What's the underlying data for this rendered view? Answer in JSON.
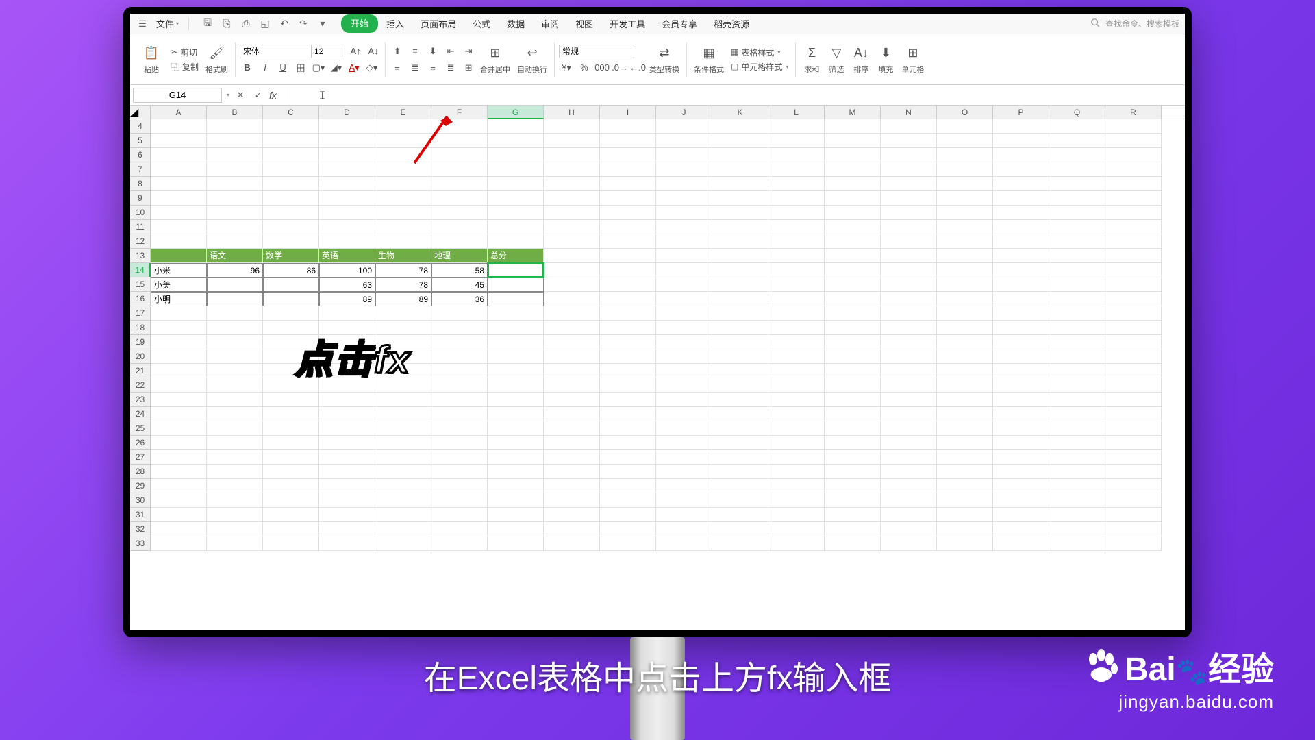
{
  "menubar": {
    "file_label": "文件",
    "tabs": [
      "开始",
      "插入",
      "页面布局",
      "公式",
      "数据",
      "审阅",
      "视图",
      "开发工具",
      "会员专享",
      "稻壳资源"
    ],
    "active_tab_index": 0,
    "search_placeholder": "查找命令、搜索模板"
  },
  "ribbon": {
    "paste": "粘贴",
    "cut": "剪切",
    "copy": "复制",
    "format_painter": "格式刷",
    "font_name": "宋体",
    "font_size": "12",
    "merge_center": "合并居中",
    "wrap_text": "自动换行",
    "number_format": "常规",
    "type_convert": "类型转换",
    "cond_format": "条件格式",
    "table_style": "表格样式",
    "cell_style": "单元格样式",
    "sum": "求和",
    "filter": "筛选",
    "sort": "排序",
    "fill": "填充",
    "cell": "单元格"
  },
  "formulabar": {
    "namebox": "G14",
    "fx": "fx",
    "value": ""
  },
  "columns": [
    "A",
    "B",
    "C",
    "D",
    "E",
    "F",
    "G",
    "H",
    "I",
    "J",
    "K",
    "L",
    "M",
    "N",
    "O",
    "P",
    "Q",
    "R"
  ],
  "selected_col": "G",
  "selected_row": 14,
  "first_row": 4,
  "last_row": 33,
  "table": {
    "header_row": 13,
    "headers": [
      "",
      "语文",
      "数学",
      "英语",
      "生物",
      "地理",
      "总分"
    ],
    "rows": [
      {
        "r": 14,
        "name": "小米",
        "vals": [
          96,
          86,
          100,
          78,
          58,
          ""
        ]
      },
      {
        "r": 15,
        "name": "小美",
        "vals": [
          "",
          "",
          63,
          78,
          45,
          ""
        ]
      },
      {
        "r": 16,
        "name": "小明",
        "vals": [
          "",
          "",
          89,
          89,
          36,
          ""
        ]
      }
    ]
  },
  "annotations": {
    "overlay_text": "点击fx",
    "caption": "在Excel表格中点击上方fx输入框"
  },
  "watermark": {
    "brand": "Baidu百度",
    "subbrand": "经验",
    "url": "jingyan.baidu.com"
  }
}
